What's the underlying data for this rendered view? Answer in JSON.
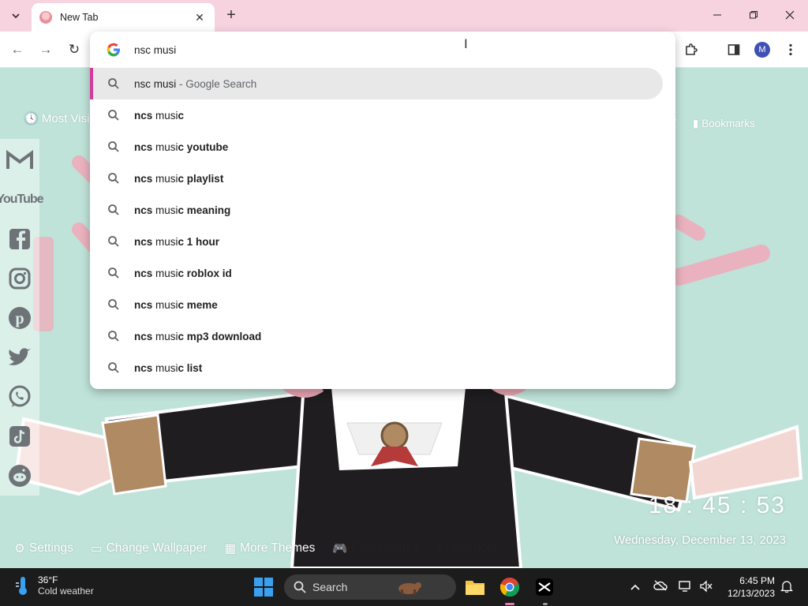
{
  "tab": {
    "title": "New Tab",
    "close_glyph": "✕",
    "new_tab_glyph": "+",
    "search_tabs_glyph": "⌄"
  },
  "window_controls": {
    "minimize": "—",
    "maximize": "❐",
    "close": "✕"
  },
  "toolbar": {
    "back_glyph": "←",
    "forward_glyph": "→",
    "reload_glyph": "↻",
    "profile_initial": "M"
  },
  "omnibox": {
    "input_value": "nsc musi",
    "suggestions": [
      {
        "prefix": "",
        "bold": "",
        "plain": "nsc musi",
        "suffix": " - Google Search"
      },
      {
        "prefix": "ncs",
        "plain": " musi",
        "bold": "c"
      },
      {
        "prefix": "ncs",
        "plain": " musi",
        "bold": "c youtube"
      },
      {
        "prefix": "ncs",
        "plain": " musi",
        "bold": "c playlist"
      },
      {
        "prefix": "ncs",
        "plain": " musi",
        "bold": "c meaning"
      },
      {
        "prefix": "ncs",
        "plain": " musi",
        "bold": "c 1 hour"
      },
      {
        "prefix": "ncs",
        "plain": " musi",
        "bold": "c roblox id"
      },
      {
        "prefix": "ncs",
        "plain": " musi",
        "bold": "c meme"
      },
      {
        "prefix": "ncs",
        "plain": " musi",
        "bold": "c mp3 download"
      },
      {
        "prefix": "ncs",
        "plain": " musi",
        "bold": "c list"
      }
    ]
  },
  "newtab": {
    "most_visited": "Most Visi",
    "bookmarks": "Bookmarks",
    "bookmarks_partial": "s",
    "clock": "18 : 45 : 53",
    "date": "Wednesday, December 13, 2023",
    "bottom": {
      "settings": "Settings",
      "change_wallpaper": "Change Wallpaper",
      "more_themes": "More Themes",
      "play_games": "Play Games",
      "new_note": "+ New note"
    },
    "social": [
      "gmail-icon",
      "youtube-icon",
      "facebook-icon",
      "instagram-icon",
      "pinterest-icon",
      "twitter-icon",
      "whatsapp-icon",
      "tiktok-icon",
      "reddit-icon"
    ],
    "youtube_text": "YouTube"
  },
  "taskbar": {
    "weather_temp": "36°F",
    "weather_desc": "Cold weather",
    "search_label": "Search",
    "time": "6:45 PM",
    "date": "12/13/2023"
  },
  "colors": {
    "tabstrip": "#f7d3e0",
    "page_bg": "#bfe3d9",
    "selected_marker": "#d63a9b",
    "taskbar": "#1c1c1c"
  }
}
